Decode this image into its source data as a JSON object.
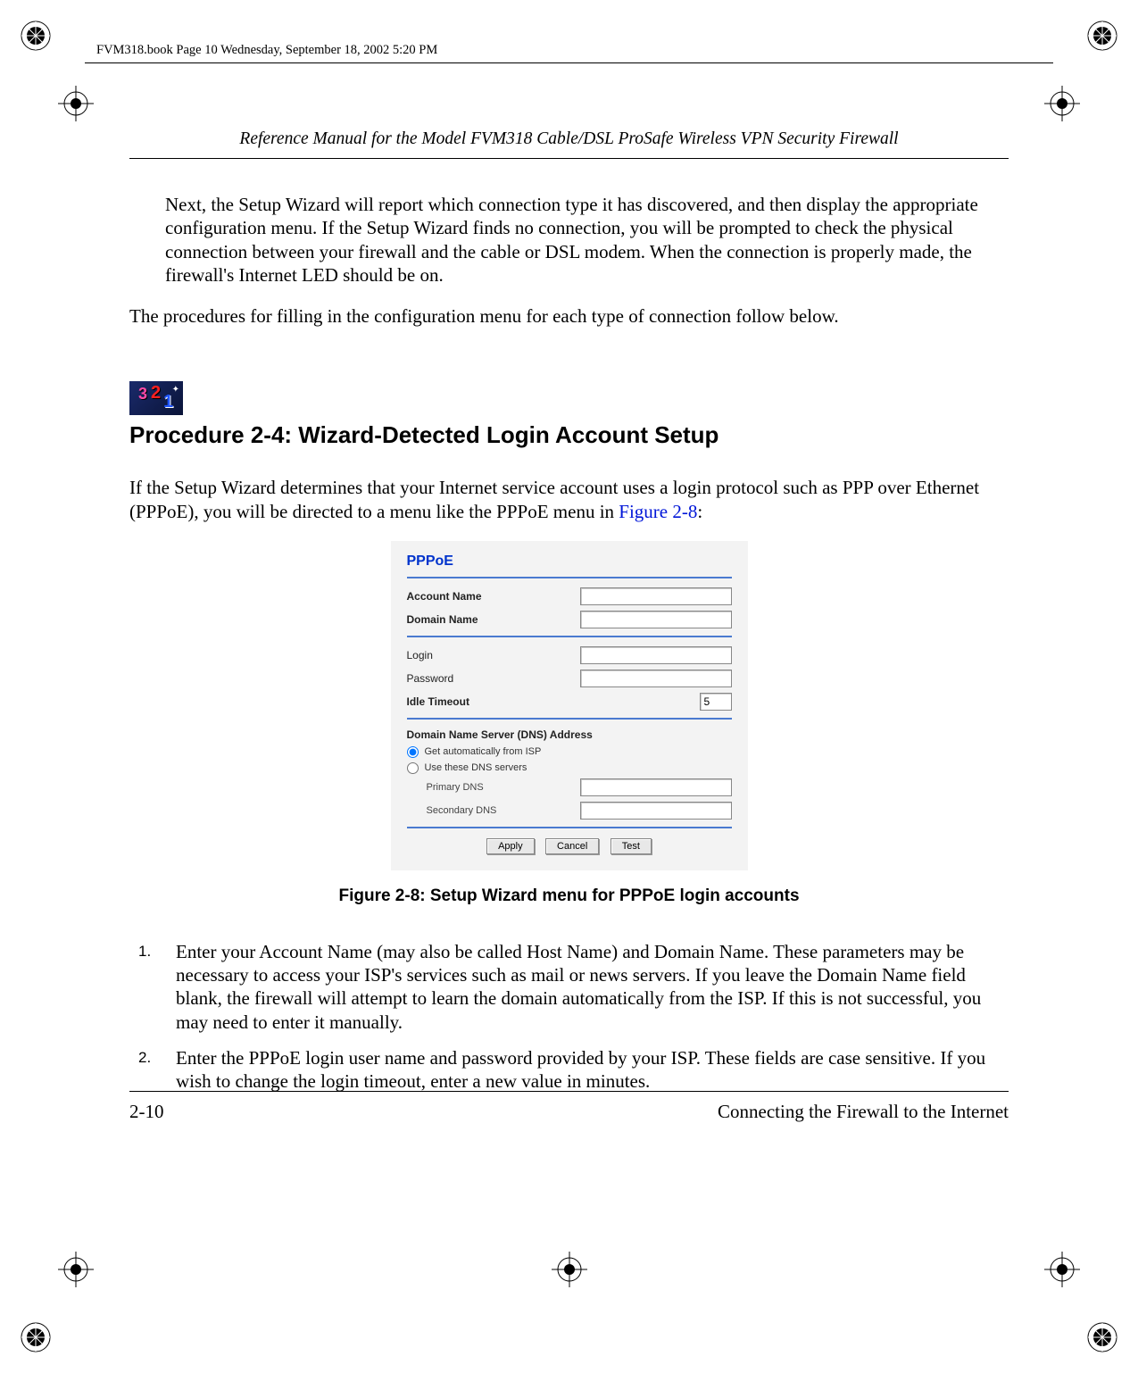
{
  "meta": {
    "page_meta": "FVM318.book  Page 10  Wednesday, September 18, 2002  5:20 PM"
  },
  "running_head": "Reference Manual for the Model FVM318 Cable/DSL ProSafe Wireless VPN Security Firewall",
  "para_intro": "Next, the Setup Wizard will report which connection type it has discovered, and then display the appropriate configuration menu. If the Setup Wizard finds no connection, you will be prompted to check the physical connection between your firewall and the cable or DSL modem. When the connection is properly made, the firewall's Internet LED should be on.",
  "para_procedures": "The procedures for filling in the configuration menu for each type of connection follow below.",
  "procedure_heading": "Procedure 2-4:  Wizard-Detected Login Account Setup",
  "para_setup_pre": "If the Setup Wizard determines that your Internet service account uses a login protocol such as PPP over Ethernet (PPPoE), you will be directed to a menu like the PPPoE menu in ",
  "figure_ref": "Figure 2-8",
  "para_setup_post": ":",
  "pppoe": {
    "title": "PPPoE",
    "account_name_label": "Account Name",
    "account_name_value": "",
    "domain_name_label": "Domain Name",
    "domain_name_value": "",
    "login_label": "Login",
    "login_value": "",
    "password_label": "Password",
    "password_value": "",
    "idle_timeout_label": "Idle Timeout",
    "idle_timeout_value": "5",
    "dns_heading": "Domain Name Server (DNS) Address",
    "dns_auto_label": "Get automatically from ISP",
    "dns_manual_label": "Use these DNS servers",
    "primary_dns_label": "Primary DNS",
    "primary_dns_value": "",
    "secondary_dns_label": "Secondary DNS",
    "secondary_dns_value": "",
    "btn_apply": "Apply",
    "btn_cancel": "Cancel",
    "btn_test": "Test"
  },
  "figure_caption": "Figure 2-8: Setup Wizard menu for PPPoE login accounts",
  "steps": {
    "s1": "Enter your Account Name (may also be called Host Name) and Domain Name. These parameters may be necessary to access your ISP's services such as mail or news servers. If you leave the Domain Name field blank, the firewall will attempt to learn the domain automatically from the ISP. If this is not successful, you may need to enter it manually.",
    "s2": "Enter the PPPoE login user name and password provided by your ISP. These fields are case sensitive. If you wish to change the login timeout, enter a new value in minutes."
  },
  "footer": {
    "page_no": "2-10",
    "section": "Connecting the Firewall to the Internet"
  }
}
